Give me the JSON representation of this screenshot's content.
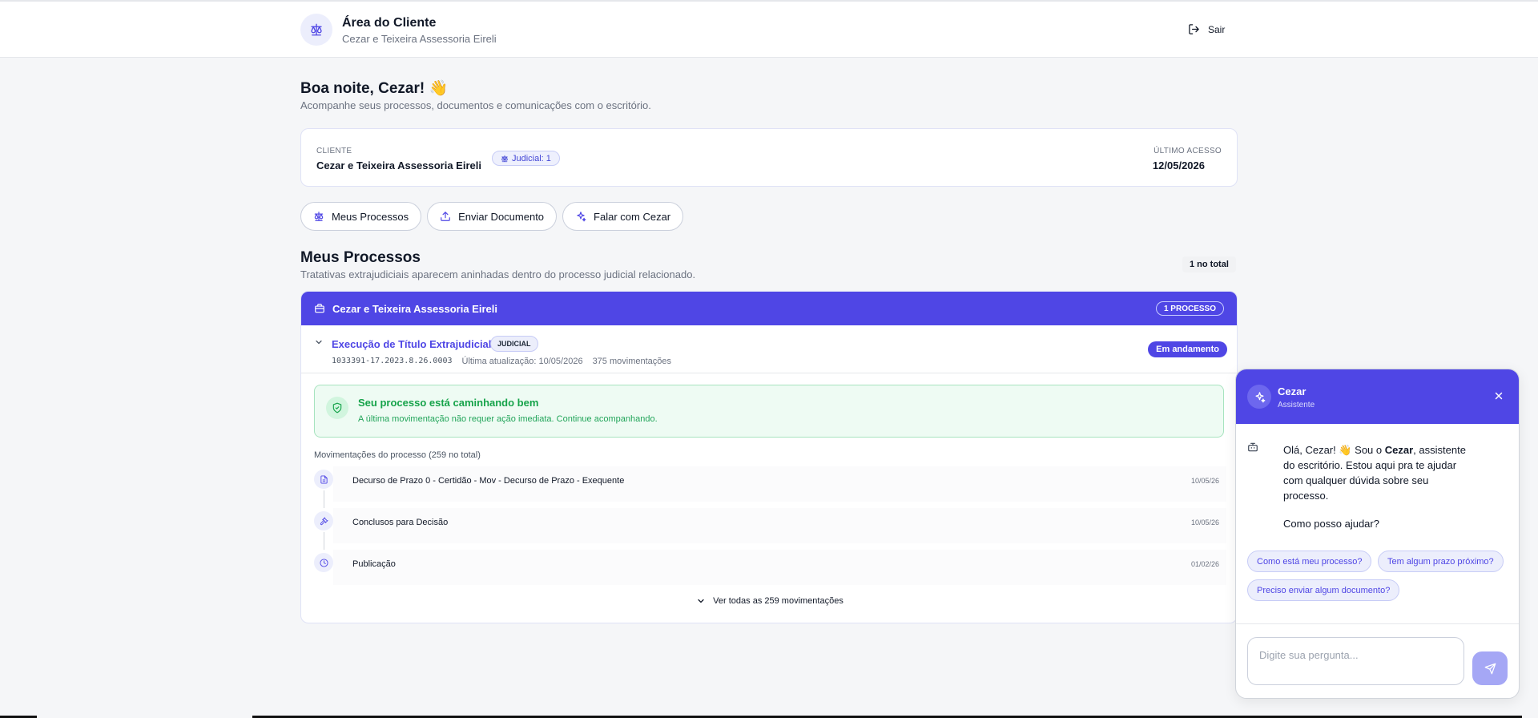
{
  "header": {
    "title": "Área do Cliente",
    "subtitle": "Cezar e Teixeira Assessoria Eireli",
    "logout_label": "Sair"
  },
  "greeting": {
    "title": "Boa noite, Cezar! 👋",
    "subtitle": "Acompanhe seus processos, documentos e comunicações com o escritório."
  },
  "client_card": {
    "client_label": "CLIENTE",
    "client_name": "Cezar e Teixeira Assessoria Eireli",
    "badge": "Judicial: 1",
    "last_access_label": "ÚLTIMO ACESSO",
    "last_access_date": "12/05/2026"
  },
  "actions": {
    "my_processes": "Meus Processos",
    "send_document": "Enviar Documento",
    "talk_to": "Falar com Cezar"
  },
  "section": {
    "title": "Meus Processos",
    "subtitle": "Tratativas extrajudiciais aparecem aninhadas dentro do processo judicial relacionado.",
    "count": "1 no total"
  },
  "group": {
    "title": "Cezar e Teixeira Assessoria Eireli",
    "badge": "1 PROCESSO"
  },
  "process": {
    "name": "Execução de Título Extrajudicial",
    "tag": "JUDICIAL",
    "number": "1033391-17.2023.8.26.0003",
    "last_update": "Última atualização: 10/05/2026",
    "movements_count": "375 movimentações",
    "status": "Em andamento"
  },
  "status_box": {
    "title": "Seu processo está caminhando bem",
    "subtitle": "A última movimentação não requer ação imediata. Continue acompanhando."
  },
  "movements": {
    "title": "Movimentações do processo (259 no total)",
    "items": [
      {
        "text": "Decurso de Prazo 0 - Certidão - Mov - Decurso de Prazo - Exequente",
        "date": "10/05/26",
        "icon": "document-icon"
      },
      {
        "text": "Conclusos para Decisão",
        "date": "10/05/26",
        "icon": "gavel-icon"
      },
      {
        "text": "Publicação",
        "date": "01/02/26",
        "icon": "clock-icon"
      }
    ],
    "see_all": "Ver todas as 259 movimentações"
  },
  "chat": {
    "name": "Cezar",
    "role": "Assistente",
    "msg_1": "Olá, Cezar! 👋 Sou o ",
    "msg_bold": "Cezar",
    "msg_2": ", assistente do escritório. Estou aqui pra te ajudar com qualquer dúvida sobre seu processo.",
    "question": "Como posso ajudar?",
    "suggestions": [
      "Como está meu processo?",
      "Tem algum prazo próximo?",
      "Preciso enviar algum documento?"
    ],
    "input_placeholder": "Digite sua pergunta..."
  },
  "colors": {
    "accent": "#4f46e5",
    "success": "#16a34a",
    "background": "#f5f6f8"
  }
}
